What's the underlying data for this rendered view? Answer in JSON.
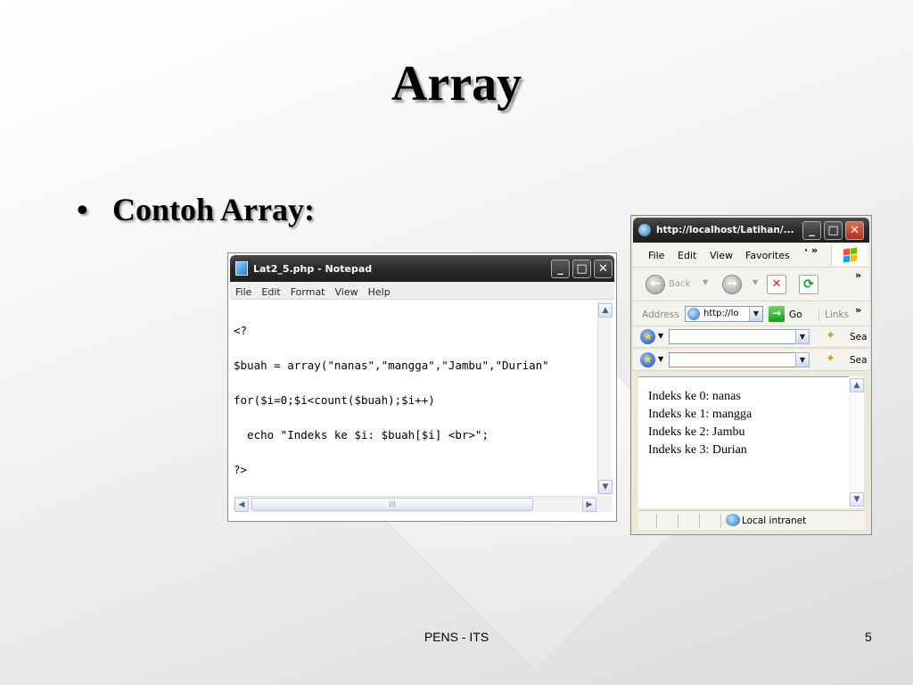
{
  "slide": {
    "title": "Array",
    "bullet_marker": "•",
    "bullet": "Contoh Array:",
    "footer": "PENS - ITS",
    "page_number": "5"
  },
  "notepad": {
    "title": "Lat2_5.php - Notepad",
    "menu": [
      "File",
      "Edit",
      "Format",
      "View",
      "Help"
    ],
    "lines": [
      "<?",
      "$buah = array(\"nanas\",\"mangga\",\"Jambu\",\"Durian\"",
      "for($i=0;$i<count($buah);$i++)",
      "  echo \"Indeks ke $i: $buah[$i] <br>\";",
      "?>"
    ],
    "hscroll_thumb_grip": "III"
  },
  "browser": {
    "title": "http://localhost/Latihan/...",
    "menu": [
      "File",
      "Edit",
      "View",
      "Favorites"
    ],
    "back_label": "Back",
    "address_label": "Address",
    "address_value": "http://lo",
    "go_label": "Go",
    "links_label": "Links",
    "search_label": "Sea",
    "output_lines": [
      "Indeks ke 0: nanas",
      "Indeks ke 1: mangga",
      "Indeks ke 2: Jambu",
      "Indeks ke 3: Durian"
    ],
    "status_zone": "Local intranet"
  },
  "icons": {
    "notepad_app": "notepad-icon",
    "browser_app": "internet-explorer-icon",
    "minimize": "minimize-icon",
    "maximize": "maximize-icon",
    "close": "close-icon",
    "back": "back-arrow-icon",
    "forward": "forward-arrow-icon",
    "stop": "stop-icon",
    "refresh": "refresh-icon",
    "go": "go-arrow-icon",
    "windows_logo": "windows-logo-icon",
    "search": "search-icon",
    "zone": "local-intranet-icon"
  },
  "colors": {
    "titlebar_dark": "#2a2a2a",
    "close_red": "#c4422a",
    "go_green": "#1a9a1a"
  }
}
